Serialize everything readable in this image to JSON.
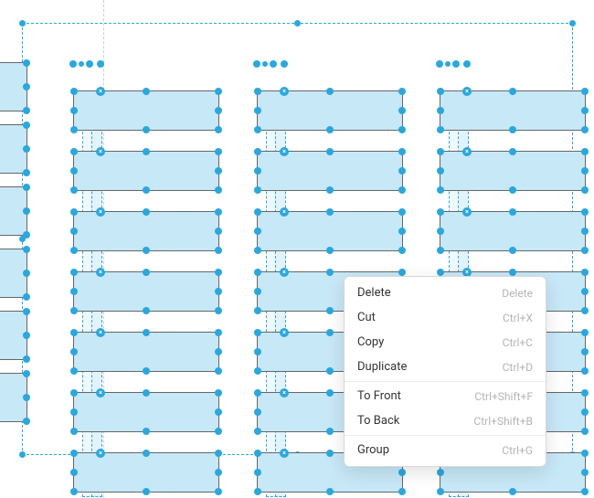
{
  "selection_color": "#29a8e0",
  "fill_color": "#c7e8f7",
  "columns": {
    "partial_left_slots": 6,
    "main_column_slots": 7,
    "main_column_count": 3
  },
  "context_menu": {
    "items": [
      {
        "label": "Delete",
        "shortcut": "Delete"
      },
      {
        "label": "Cut",
        "shortcut": "Ctrl+X"
      },
      {
        "label": "Copy",
        "shortcut": "Ctrl+C"
      },
      {
        "label": "Duplicate",
        "shortcut": "Ctrl+D",
        "sep_after": true
      },
      {
        "label": "To Front",
        "shortcut": "Ctrl+Shift+F"
      },
      {
        "label": "To Back",
        "shortcut": "Ctrl+Shift+B",
        "sep_after": true
      },
      {
        "label": "Group",
        "shortcut": "Ctrl+G"
      }
    ]
  }
}
